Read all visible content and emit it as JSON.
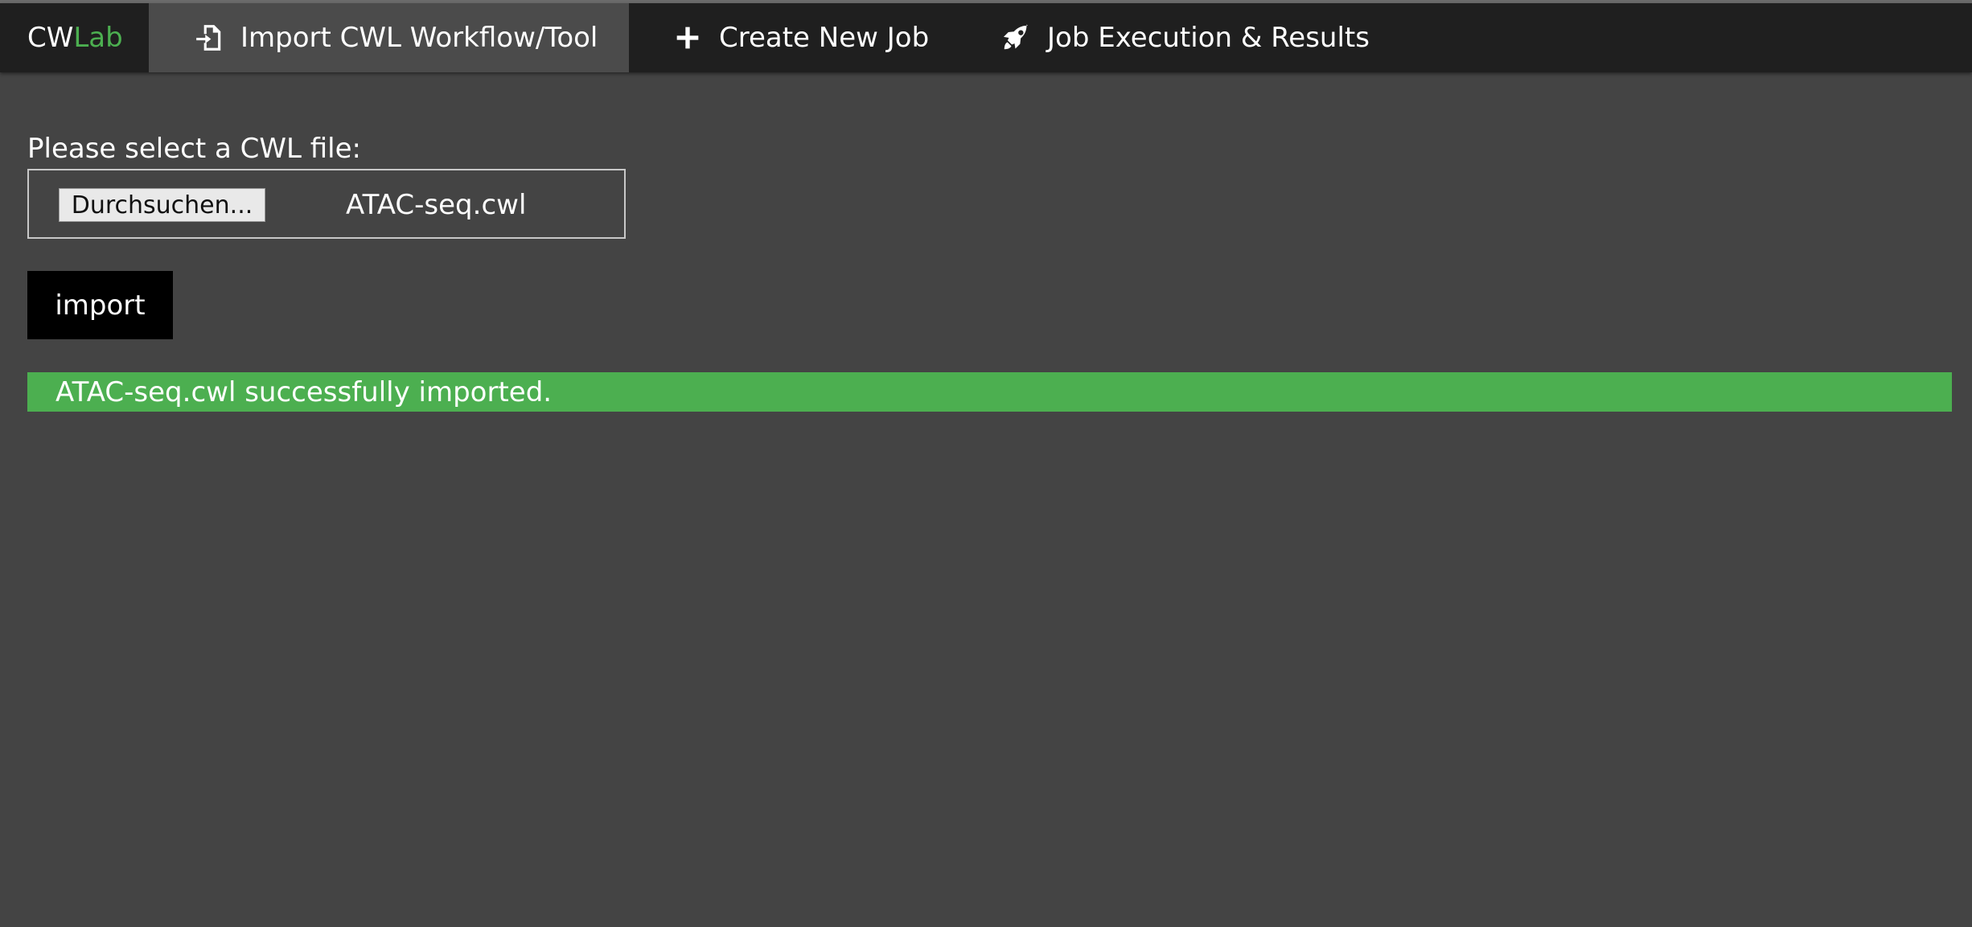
{
  "brand": {
    "prefix": "CW",
    "suffix": "Lab"
  },
  "nav": {
    "tabs": [
      {
        "label": "Import CWL Workflow/Tool",
        "icon": "file-import-icon",
        "active": true
      },
      {
        "label": "Create New Job",
        "icon": "plus-icon",
        "active": false
      },
      {
        "label": "Job Execution & Results",
        "icon": "rocket-icon",
        "active": false
      }
    ]
  },
  "form": {
    "select_label": "Please select a CWL file:",
    "browse_label": "Durchsuchen...",
    "file_name": "ATAC-seq.cwl",
    "import_label": "import"
  },
  "status": {
    "message": "ATAC-seq.cwl successfully imported.",
    "color": "#4caf50"
  },
  "colors": {
    "background": "#444444",
    "navbar": "#1f1f1f",
    "active_tab": "#4b4b4b",
    "accent": "#4caf50"
  }
}
